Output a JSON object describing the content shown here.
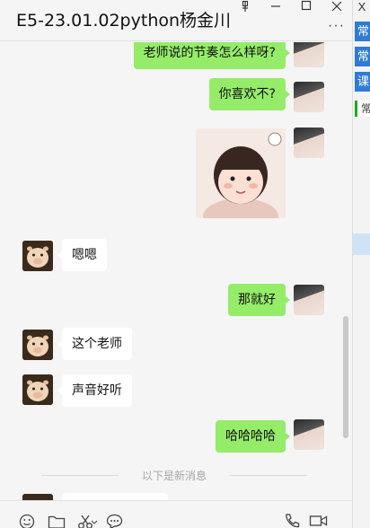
{
  "window": {
    "title": "E5-23.01.02python杨金川",
    "more_label": "···"
  },
  "messages": {
    "m1": "老师说的节奏怎么样呀?",
    "m2": "你喜欢不?",
    "m3": "嗯嗯",
    "m4": "那就好",
    "m5": "这个老师",
    "m6": "声音好听",
    "m7": "哈哈哈哈"
  },
  "divider_text": "以下是新消息",
  "side_panel": {
    "close_label": "X",
    "tabs": [
      "常",
      "常",
      "课"
    ],
    "item_label": "常"
  },
  "colors": {
    "outgoing_bubble": "#95ec69",
    "incoming_bubble": "#ffffff",
    "background": "#f5f5f5",
    "side_tab": "#2f7cd6"
  },
  "icons": [
    "pin-icon",
    "minimize-icon",
    "maximize-icon",
    "close-icon",
    "emoji-icon",
    "folder-icon",
    "scissors-icon",
    "chat-bubble-icon",
    "phone-icon",
    "video-icon"
  ]
}
